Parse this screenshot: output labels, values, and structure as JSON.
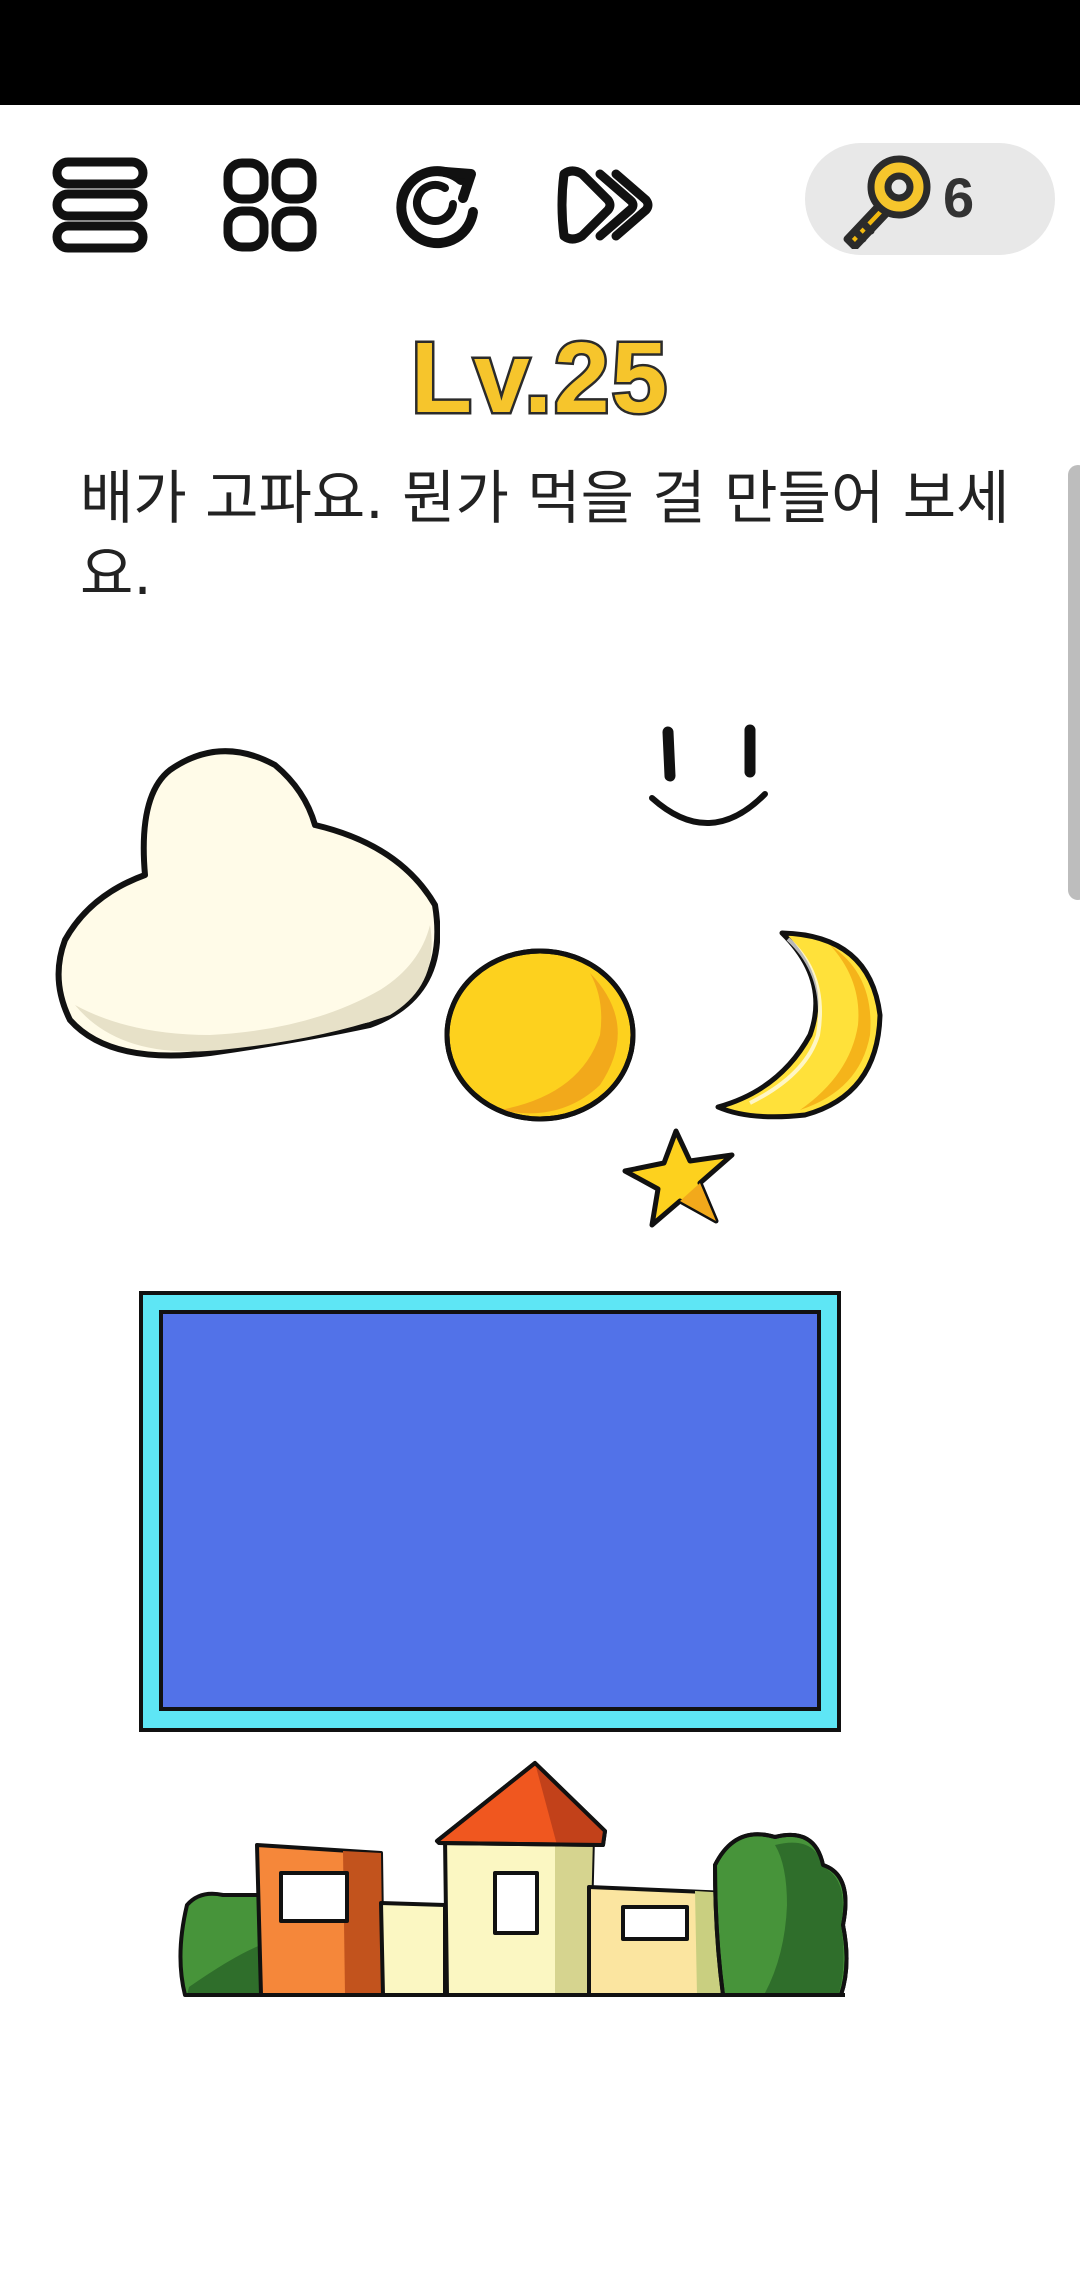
{
  "toolbar": {
    "menu_icon": "menu-icon",
    "levels_icon": "grid-icon",
    "restart_icon": "restart-icon",
    "skip_icon": "fast-forward-icon"
  },
  "keys": {
    "icon": "key-icon",
    "count": "6"
  },
  "level": {
    "title": "Lv.25",
    "question": "배가 고파요. 뭔가 먹을 걸 만들어 보세요."
  },
  "scene": {
    "items": [
      "cloud",
      "sun-smile",
      "yellow-circle",
      "crescent-moon",
      "star",
      "blue-screen",
      "village"
    ]
  },
  "colors": {
    "title_yellow": "#f6c52c",
    "cloud_cream": "#fffbe8",
    "sun_yellow": "#fdd11e",
    "moon_yellow": "#ffe13a",
    "screen_blue": "#5272e8",
    "screen_frame": "#5ee6f5",
    "badge_gray": "#e8e8e8"
  }
}
